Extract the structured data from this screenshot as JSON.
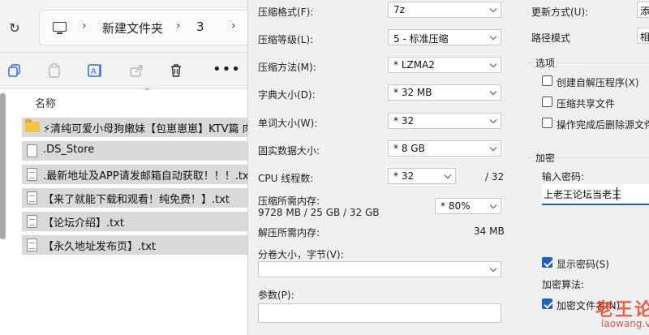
{
  "explorer": {
    "breadcrumb": [
      "新建文件夹",
      "3"
    ],
    "column_header": "名称",
    "files": [
      {
        "name": "⚡清纯可爱小母狗嫩妹【包崽崽崽】KTV篇 肉",
        "type": "folder"
      },
      {
        "name": ".DS_Store",
        "type": "file"
      },
      {
        "name": ".最新地址及APP请发邮箱自动获取！！！.txt",
        "type": "txt"
      },
      {
        "name": "【来了就能下载和观看！纯免费！】.txt",
        "type": "txt"
      },
      {
        "name": "【论坛介绍】.txt",
        "type": "txt"
      },
      {
        "name": "【永久地址发布页】.txt",
        "type": "txt"
      }
    ]
  },
  "dialog": {
    "format": {
      "label": "压缩格式(F):",
      "value": "7z"
    },
    "level": {
      "label": "压缩等级(L):",
      "value": "5 - 标准压缩"
    },
    "method": {
      "label": "压缩方法(M):",
      "value": "*  LZMA2"
    },
    "dict": {
      "label": "字典大小(D):",
      "value": "*  32 MB"
    },
    "word": {
      "label": "单词大小(W):",
      "value": "*  32"
    },
    "solid": {
      "label": "固实数据大小:",
      "value": "*  8 GB"
    },
    "cpu": {
      "label": "CPU 线程数:",
      "value": "*  32",
      "total": "/ 32"
    },
    "mem_comp": {
      "label": "压缩所需内存:",
      "detail": "9728 MB / 25 GB / 32 GB",
      "value": "*  80%"
    },
    "mem_decomp": {
      "label": "解压所需内存:",
      "value": "34 MB"
    },
    "volume": {
      "label": "分卷大小，字节(V):",
      "value": ""
    },
    "params": {
      "label": "参数(P):",
      "value": ""
    },
    "update": {
      "label": "更新方式(U):",
      "value": "添"
    },
    "path": {
      "label": "路径模式",
      "value": "相"
    },
    "options": {
      "title": "选项",
      "sfx": "创建自解压程序(X)",
      "shared": "压缩共享文件",
      "delete": "操作完成后删除源文件"
    },
    "encryption": {
      "title": "加密",
      "pw_label": "输入密码:",
      "pw_value": "上老王论坛当老王",
      "show_pw": "显示密码(S)",
      "method_label": "加密算法:",
      "encrypt_names": "加密文件名(N)"
    }
  },
  "watermark": {
    "text": "老王论坛",
    "url": "laowang.vip"
  },
  "colors": {
    "accent": "#1f5fbf",
    "selection": "#d9d9d9",
    "folder": "#f5c244",
    "watermark": "#e8462c"
  }
}
